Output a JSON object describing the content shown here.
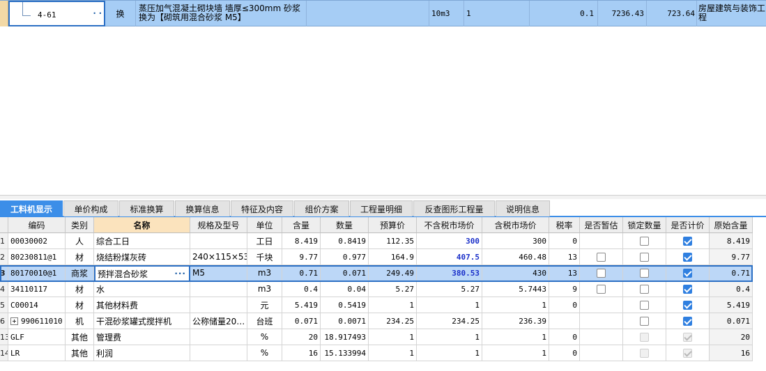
{
  "quota_row": {
    "code": "4-61",
    "type": "换",
    "name_line1": "蒸压加气混凝土砌块墙 墙厚≤300mm 砂浆",
    "name_line2": "换为【砌筑用混合砂浆 M5】",
    "unit": "10m3",
    "quantity": "1",
    "qty_value": "0.1",
    "unit_price": "7236.43",
    "total_price": "723.64",
    "profession_line1": "房屋建筑与装饰工",
    "profession_line2": "程"
  },
  "tabs": [
    {
      "label": "工料机显示",
      "active": true
    },
    {
      "label": "单价构成"
    },
    {
      "label": "标准换算"
    },
    {
      "label": "换算信息"
    },
    {
      "label": "特征及内容"
    },
    {
      "label": "组价方案"
    },
    {
      "label": "工程量明细"
    },
    {
      "label": "反查图形工程量"
    },
    {
      "label": "说明信息"
    }
  ],
  "grid": {
    "headers": {
      "code": "编码",
      "category": "类别",
      "name": "名称",
      "spec": "规格及型号",
      "unit": "单位",
      "content": "含量",
      "quantity": "数量",
      "budget_price": "预算价",
      "market_price_ex_tax": "不含税市场价",
      "market_price_inc_tax": "含税市场价",
      "tax_rate": "税率",
      "is_provisional": "是否暂估",
      "lock_quantity": "锁定数量",
      "is_priced": "是否计价",
      "original_content": "原始含量"
    },
    "rows": [
      {
        "num": "1",
        "code": "00030002",
        "category": "人",
        "name": "综合工日",
        "spec": "",
        "unit": "工日",
        "content": "8.419",
        "quantity": "0.8419",
        "budget": "112.35",
        "market_ex": "300",
        "market_inc": "300",
        "tax": "0",
        "orig": "8.419"
      },
      {
        "num": "2",
        "code": "80230811@1",
        "category": "材",
        "name": "烧结粉煤灰砖",
        "spec": "240×115×53",
        "unit": "千块",
        "content": "9.77",
        "quantity": "0.977",
        "budget": "164.9",
        "market_ex": "407.5",
        "market_inc": "460.48",
        "tax": "13",
        "orig": "9.77"
      },
      {
        "num": "3",
        "code": "80170010@1",
        "category": "商浆",
        "name": "预拌混合砂浆",
        "spec": "M5",
        "unit": "m3",
        "content": "0.71",
        "quantity": "0.071",
        "budget": "249.49",
        "market_ex": "380.53",
        "market_inc": "430",
        "tax": "13",
        "orig": "0.71"
      },
      {
        "num": "4",
        "code": "34110117",
        "category": "材",
        "name": "水",
        "spec": "",
        "unit": "m3",
        "content": "0.4",
        "quantity": "0.04",
        "budget": "5.27",
        "market_ex": "5.27",
        "market_inc": "5.7443",
        "tax": "9",
        "orig": "0.4"
      },
      {
        "num": "5",
        "code": "C00014",
        "category": "材",
        "name": "其他材料费",
        "spec": "",
        "unit": "元",
        "content": "5.419",
        "quantity": "0.5419",
        "budget": "1",
        "market_ex": "1",
        "market_inc": "1",
        "tax": "0",
        "orig": "5.419"
      },
      {
        "num": "6",
        "code": "990611010",
        "category": "机",
        "name": "干混砂浆罐式搅拌机",
        "spec": "公称储量20…",
        "unit": "台班",
        "content": "0.071",
        "quantity": "0.0071",
        "budget": "234.25",
        "market_ex": "234.25",
        "market_inc": "236.39",
        "tax": "",
        "orig": "0.071"
      },
      {
        "num": "13",
        "code": "GLF",
        "category": "其他",
        "name": "管理费",
        "spec": "",
        "unit": "%",
        "content": "20",
        "quantity": "18.917493",
        "budget": "1",
        "market_ex": "1",
        "market_inc": "1",
        "tax": "0",
        "orig": "20"
      },
      {
        "num": "14",
        "code": "LR",
        "category": "其他",
        "name": "利润",
        "spec": "",
        "unit": "%",
        "content": "16",
        "quantity": "15.133994",
        "budget": "1",
        "market_ex": "1",
        "market_inc": "1",
        "tax": "0",
        "orig": "16"
      }
    ]
  },
  "colors": {
    "accent": "#3c8ee8",
    "selected_row": "#bcd7f7",
    "quota_row": "#a6cdf5",
    "highlight_header": "#fbe3bd",
    "price_blue": "#1a2fc9"
  }
}
